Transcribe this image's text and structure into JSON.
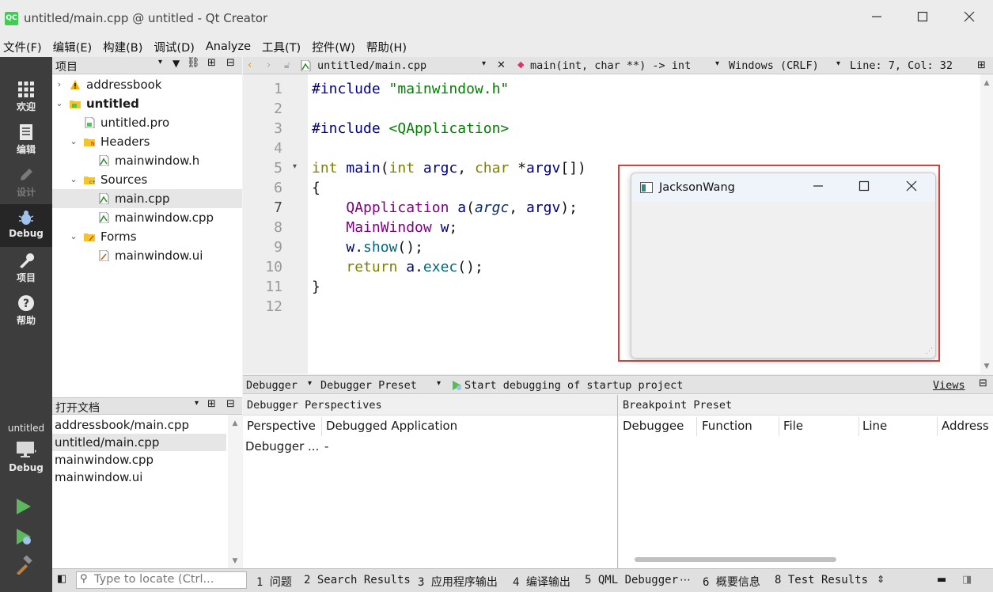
{
  "window": {
    "logo": "QC",
    "title": "untitled/main.cpp @ untitled - Qt Creator"
  },
  "menu": [
    "文件(F)",
    "编辑(E)",
    "构建(B)",
    "调试(D)",
    "Analyze",
    "工具(T)",
    "控件(W)",
    "帮助(H)"
  ],
  "modes": [
    {
      "label": "欢迎",
      "icon": "grid-icon"
    },
    {
      "label": "编辑",
      "icon": "document-icon"
    },
    {
      "label": "设计",
      "icon": "pencil-icon"
    },
    {
      "label": "Debug",
      "icon": "bug-icon"
    },
    {
      "label": "项目",
      "icon": "wrench-icon"
    },
    {
      "label": "帮助",
      "icon": "help-icon"
    }
  ],
  "kit": {
    "project": "untitled",
    "config": "Debug"
  },
  "project_panel": {
    "title": "项目",
    "tree": [
      {
        "label": "addressbook",
        "depth": 0,
        "arrow": "›",
        "icon": "warning-icon"
      },
      {
        "label": "untitled",
        "depth": 0,
        "arrow": "⌄",
        "icon": "project-folder-icon",
        "bold": true
      },
      {
        "label": "untitled.pro",
        "depth": 1,
        "arrow": "",
        "icon": "pro-file-icon"
      },
      {
        "label": "Headers",
        "depth": 1,
        "arrow": "⌄",
        "icon": "folder-h-icon"
      },
      {
        "label": "mainwindow.h",
        "depth": 2,
        "arrow": "",
        "icon": "header-file-icon"
      },
      {
        "label": "Sources",
        "depth": 1,
        "arrow": "⌄",
        "icon": "folder-cpp-icon"
      },
      {
        "label": "main.cpp",
        "depth": 2,
        "arrow": "",
        "icon": "cpp-file-icon",
        "selected": true
      },
      {
        "label": "mainwindow.cpp",
        "depth": 2,
        "arrow": "",
        "icon": "cpp-file-icon"
      },
      {
        "label": "Forms",
        "depth": 1,
        "arrow": "⌄",
        "icon": "folder-ui-icon"
      },
      {
        "label": "mainwindow.ui",
        "depth": 2,
        "arrow": "",
        "icon": "ui-file-icon"
      }
    ]
  },
  "open_docs": {
    "title": "打开文档",
    "items": [
      "addressbook/main.cpp",
      "untitled/main.cpp",
      "mainwindow.cpp",
      "mainwindow.ui"
    ],
    "selected_index": 1
  },
  "editor_toolbar": {
    "file": "untitled/main.cpp",
    "symbol": "main(int, char **) -> int",
    "line_ending": "Windows (CRLF)",
    "position": "Line: 7, Col: 32"
  },
  "editor": {
    "current_line": 7,
    "line_numbers": [
      "1",
      "2",
      "3",
      "4",
      "5",
      "6",
      "7",
      "8",
      "9",
      "10",
      "11",
      "12"
    ]
  },
  "app_window": {
    "title": "JacksonWang"
  },
  "debugger_bar": {
    "debugger": "Debugger",
    "preset": "Debugger Preset",
    "start": "Start debugging of startup project",
    "views": "Views"
  },
  "perspectives": {
    "title": "Debugger Perspectives",
    "columns": [
      "Perspective",
      "Debugged Application"
    ],
    "rows": [
      [
        "Debugger ...",
        "-"
      ]
    ]
  },
  "breakpoints": {
    "title": "Breakpoint Preset",
    "columns": [
      "Debuggee",
      "Function",
      "File",
      "Line",
      "Address"
    ]
  },
  "status_bar": {
    "locate_placeholder": "Type to locate (Ctrl...",
    "tabs": [
      "1 问题",
      "2 Search Results",
      "3 应用程序输出",
      "4 编译输出",
      "5 QML Debugger",
      "6 概要信息",
      "8 Test Results"
    ]
  }
}
